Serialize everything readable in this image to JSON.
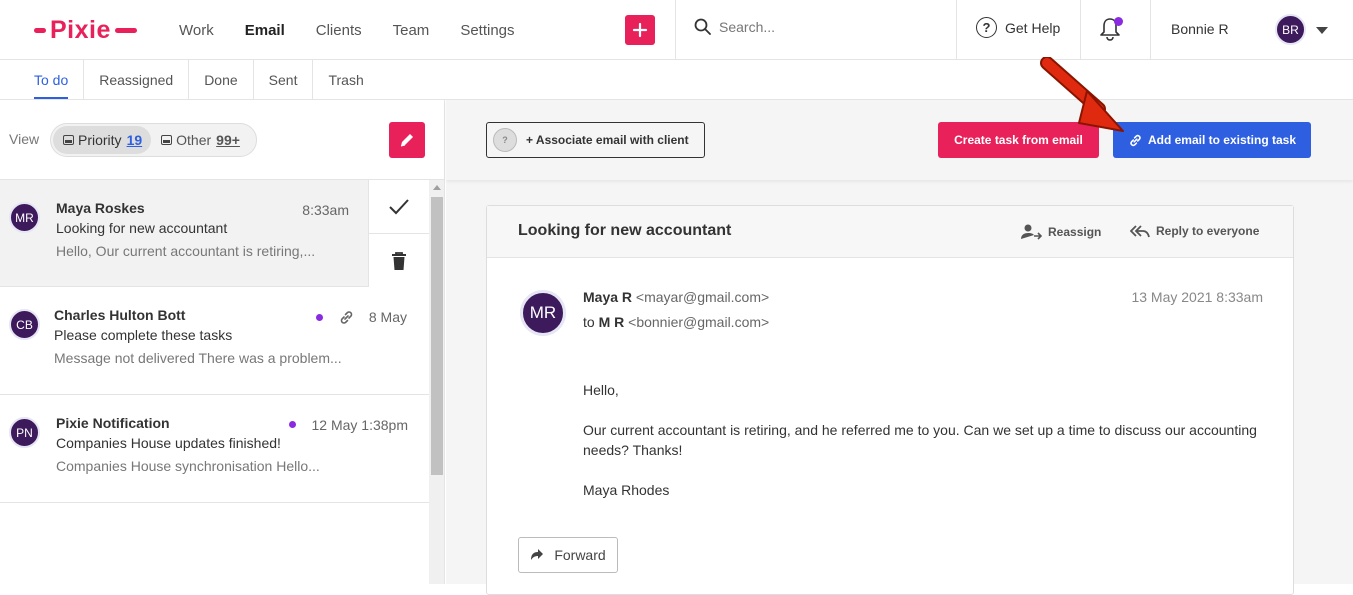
{
  "app": {
    "logo_text": "Pixie",
    "nav": [
      "Work",
      "Email",
      "Clients",
      "Team",
      "Settings"
    ],
    "search_placeholder": "Search...",
    "help_label": "Get Help",
    "user_name": "Bonnie R",
    "user_initials": "BR",
    "brand_color": "#e9215a",
    "accent_color": "#2d5fe0"
  },
  "tabs": [
    "To do",
    "Reassigned",
    "Done",
    "Sent",
    "Trash"
  ],
  "view": {
    "label": "View",
    "priority_label": "Priority",
    "priority_count": "19",
    "other_label": "Other",
    "other_count": "99+"
  },
  "emails": [
    {
      "initials": "MR",
      "from": "Maya Roskes",
      "subject": "Looking for new accountant",
      "preview": "Hello, Our current accountant is retiring,...",
      "time": "8:33am"
    },
    {
      "initials": "CB",
      "from": "Charles Hulton Bott",
      "subject": "Please complete these tasks",
      "preview": "Message not delivered There was a problem...",
      "time": "8 May"
    },
    {
      "initials": "PN",
      "from": "Pixie Notification",
      "subject": "Companies House updates finished!",
      "preview": "Companies House synchronisation Hello...",
      "time": "12 May 1:38pm"
    }
  ],
  "actions": {
    "associate_label": "+ Associate email with client",
    "associate_icon_text": "?",
    "create_task_label": "Create task from email",
    "add_task_label": "Add email to existing task"
  },
  "message": {
    "title": "Looking for new accountant",
    "reassign_label": "Reassign",
    "reply_all_label": "Reply to everyone",
    "sender_initials": "MR",
    "from_name": "Maya R",
    "from_email": "<mayar@gmail.com>",
    "to_prefix": "to",
    "to_name": "M R",
    "to_email": "<bonnier@gmail.com>",
    "date": "13 May 2021 8:33am",
    "body": [
      "Hello,",
      "Our current accountant is retiring, and he referred me to you. Can we set up a time to discuss our accounting needs? Thanks!",
      "Maya Rhodes"
    ],
    "forward_label": "Forward"
  }
}
